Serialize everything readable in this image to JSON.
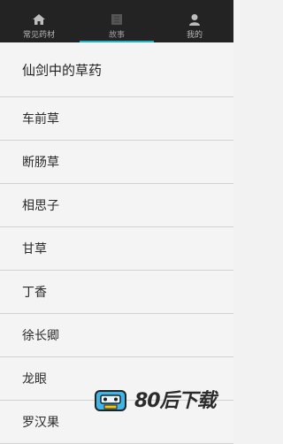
{
  "tabs": [
    {
      "label": "常见药材",
      "icon": "home-icon",
      "active": false
    },
    {
      "label": "故事",
      "icon": "book-icon",
      "active": true
    },
    {
      "label": "我的",
      "icon": "person-icon",
      "active": false
    }
  ],
  "accent_color": "#20b2c9",
  "list": {
    "items": [
      "仙剑中的草药",
      "车前草",
      "断肠草",
      "相思子",
      "甘草",
      "丁香",
      "徐长卿",
      "龙眼",
      "罗汉果"
    ]
  },
  "watermark": {
    "text": "80后下载"
  }
}
